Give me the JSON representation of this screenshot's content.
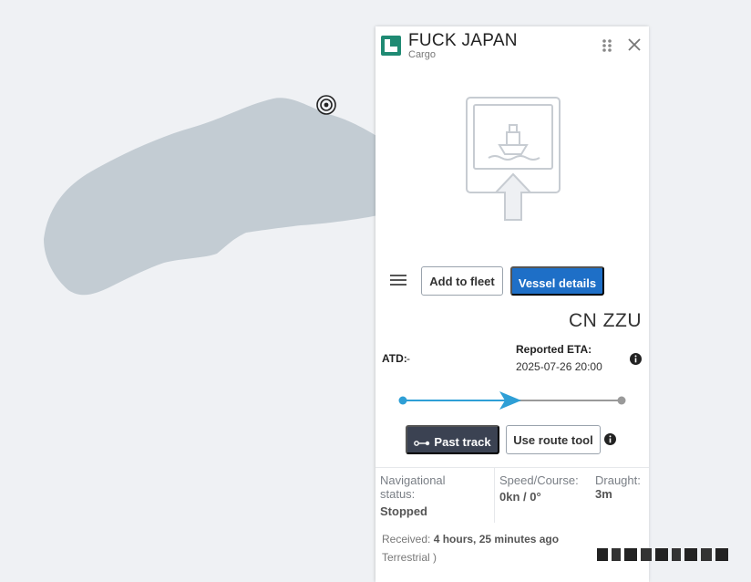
{
  "colors": {
    "map_background": "#eff1f4",
    "island": "#c3ccd3",
    "primary_button": "#1e6fc7",
    "dark_button": "#3b4252",
    "route_progress": "#2e9fd6",
    "flag": "#1f8a73"
  },
  "map": {
    "marker_icon": "target-icon"
  },
  "header": {
    "vessel_name": "FUCK JAPAN",
    "vessel_type": "Cargo",
    "flag_icon": "flag-icon",
    "drag_icon": "drag-icon",
    "close_icon": "close-icon"
  },
  "photo": {
    "icon": "ship-photo-upload-icon"
  },
  "actions": {
    "menu_icon": "menu-icon",
    "add_to_fleet": "Add to fleet",
    "vessel_details": "Vessel details"
  },
  "voyage": {
    "destination_callsign": "CN ZZU",
    "atd_label": "ATD:",
    "atd_value": "-",
    "eta_label": "Reported ETA:",
    "eta_value": "2025-07-26 20:00",
    "progress": 0.5
  },
  "route_buttons": {
    "past_track": "Past track",
    "use_route_tool": "Use route tool"
  },
  "status": {
    "nav_label": "Navigational status:",
    "nav_value": "Stopped",
    "speed_label": "Speed/Course:",
    "speed_value": "0kn / 0°",
    "draught_label": "Draught:",
    "draught_value": "3m"
  },
  "received": {
    "label": "Received:",
    "value": "4 hours, 25 minutes ago",
    "source": "Terrestrial )"
  }
}
